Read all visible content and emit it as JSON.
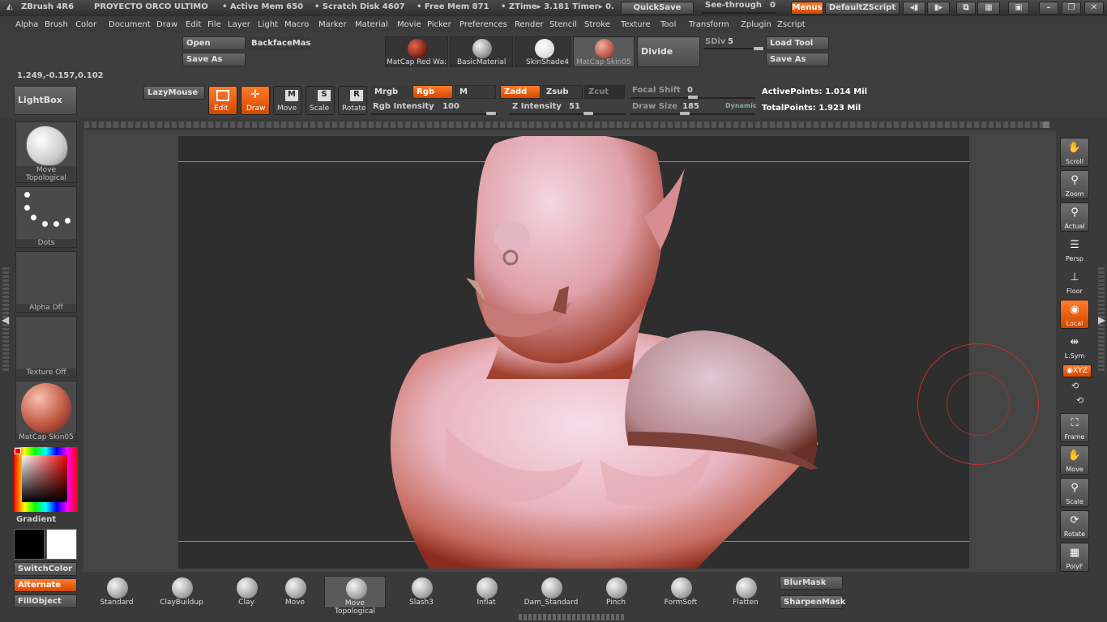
{
  "titlebar": {
    "app": "ZBrush 4R6",
    "project": "PROYECTO ORCO ULTIMO",
    "active_mem": "• Active Mem 650",
    "scratch": "• Scratch Disk 4607",
    "free_mem": "• Free Mem 871",
    "ztime": "• ZTime▸ 3.181  Timer▸ 0.",
    "quicksave": "QuickSave",
    "seethrough": "See-through",
    "seethrough_val": "0",
    "menus": "Menus",
    "script": "DefaultZScript"
  },
  "menubar": [
    "Alpha",
    "Brush",
    "Color",
    "Document",
    "Draw",
    "Edit",
    "File",
    "Layer",
    "Light",
    "Macro",
    "Marker",
    "Material",
    "Movie",
    "Picker",
    "Preferences",
    "Render",
    "Stencil",
    "Stroke",
    "Texture",
    "Tool",
    "Transform",
    "Zplugin",
    "Zscript"
  ],
  "shelf": {
    "open": "Open",
    "saveas1": "Save As",
    "backface": "BackfaceMas",
    "materials": [
      {
        "label": "MatCap Red Wa:",
        "color": "#a03020"
      },
      {
        "label": "BasicMaterial",
        "color": "#bdbdbd"
      },
      {
        "label": "SkinShade4",
        "color": "#f2f2f2"
      },
      {
        "label": "MatCap Skin05",
        "color": "#c86a58"
      }
    ],
    "divide": "Divide",
    "sdiv_label": "SDiv",
    "sdiv_val": "5",
    "loadtool": "Load Tool",
    "saveas2": "Save As",
    "coords": "1.249,-0.157,0.102",
    "lightbox": "LightBox",
    "lazymouse": "LazyMouse",
    "edit": "Edit",
    "draw": "Draw",
    "move": "Move",
    "scale": "Scale",
    "rotate": "Rotate",
    "mrgb": "Mrgb",
    "rgb": "Rgb",
    "m": "M",
    "zadd": "Zadd",
    "zsub": "Zsub",
    "zcut": "Zcut",
    "rgb_int_label": "Rgb Intensity",
    "rgb_int_val": "100",
    "z_int_label": "Z Intensity",
    "z_int_val": "51",
    "focal_label": "Focal Shift",
    "focal_val": "0",
    "drawsize_label": "Draw Size",
    "drawsize_val": "185",
    "dynamic": "Dynamic",
    "activepoints": "ActivePoints: 1.014 Mil",
    "totalpoints": "TotalPoints: 1.923 Mil"
  },
  "leftpanel": {
    "tool_thumb": "Move Topological",
    "stroke_thumb": "Dots",
    "alpha_thumb": "Alpha Off",
    "texture_thumb": "Texture Off",
    "material_thumb": "MatCap Skin05",
    "gradient": "Gradient",
    "switchcolor": "SwitchColor",
    "alternate": "Alternate",
    "fillobject": "FillObject"
  },
  "rightpanel": [
    {
      "label": "Scroll",
      "icon": "hand-icon"
    },
    {
      "label": "Zoom",
      "icon": "magnifier-icon"
    },
    {
      "label": "Actual",
      "icon": "magnifier-icon"
    },
    {
      "label": "Persp",
      "icon": "grid-icon"
    },
    {
      "label": "Floor",
      "icon": "floor-icon"
    },
    {
      "label": "Local",
      "icon": "local-icon"
    },
    {
      "label": "L.Sym",
      "icon": "sym-icon"
    },
    {
      "label": "◉XYZ",
      "icon": "xyz-icon"
    },
    {
      "label": "Frame",
      "icon": "frame-icon"
    },
    {
      "label": "Move",
      "icon": "hand-icon"
    },
    {
      "label": "Scale",
      "icon": "magnifier-icon"
    },
    {
      "label": "Rotate",
      "icon": "rotate-icon"
    },
    {
      "label": "PolyF",
      "icon": "grid-icon"
    }
  ],
  "brushes": [
    "Standard",
    "ClayBuildup",
    "Clay",
    "Move",
    "Move Topological",
    "Slash3",
    "Inflat",
    "Dam_Standard",
    "Pinch",
    "FormSoft",
    "Flatten"
  ],
  "bottom": {
    "blurmask": "BlurMask",
    "sharpenmask": "SharpenMask"
  }
}
